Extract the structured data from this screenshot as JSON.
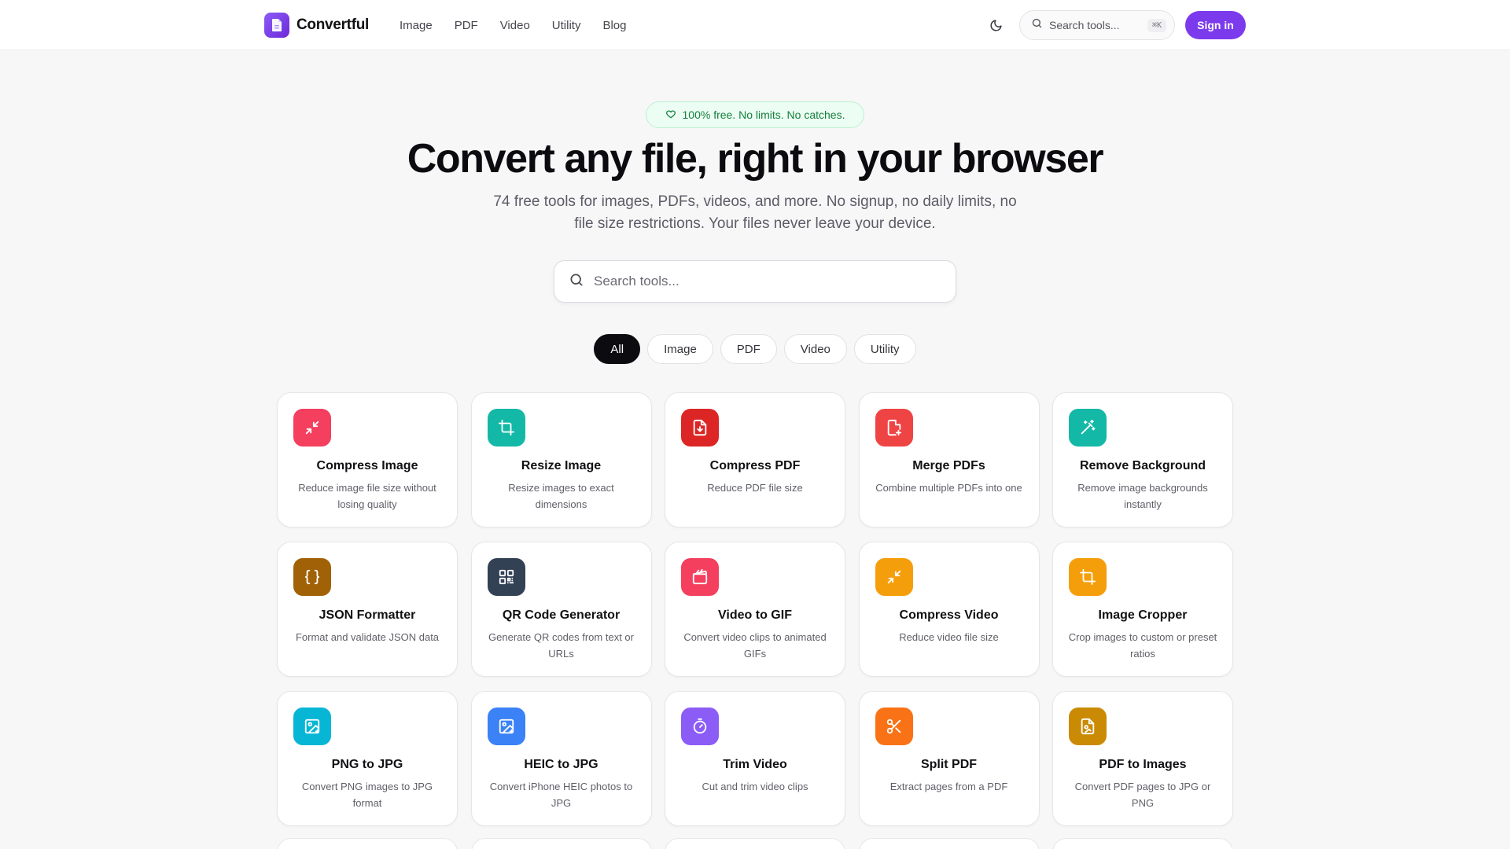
{
  "header": {
    "logo_text": "Convertful",
    "nav": [
      "Image",
      "PDF",
      "Video",
      "Utility",
      "Blog"
    ],
    "search_placeholder": "Search tools...",
    "search_shortcut": "⌘K",
    "signin_label": "Sign in"
  },
  "hero": {
    "badge": "100% free. No limits. No catches.",
    "title": "Convert any file, right in your browser",
    "subtitle_line1": "74 free tools for images, PDFs, videos, and more. No signup, no daily limits, no",
    "subtitle_line2": "file size restrictions. Your files never leave your device.",
    "search_placeholder": "Search tools..."
  },
  "filters": [
    {
      "label": "All",
      "active": true
    },
    {
      "label": "Image",
      "active": false
    },
    {
      "label": "PDF",
      "active": false
    },
    {
      "label": "Video",
      "active": false
    },
    {
      "label": "Utility",
      "active": false
    }
  ],
  "tools": [
    {
      "title": "Compress Image",
      "desc": "Reduce image file size without losing quality",
      "color": "#f43f5e",
      "icon": "compress-arrows-icon"
    },
    {
      "title": "Resize Image",
      "desc": "Resize images to exact dimensions",
      "color": "#14b8a6",
      "icon": "crop-icon"
    },
    {
      "title": "Compress PDF",
      "desc": "Reduce PDF file size",
      "color": "#dc2626",
      "icon": "file-download-icon"
    },
    {
      "title": "Merge PDFs",
      "desc": "Combine multiple PDFs into one",
      "color": "#ef4444",
      "icon": "file-plus-icon"
    },
    {
      "title": "Remove Background",
      "desc": "Remove image backgrounds instantly",
      "color": "#14b8a6",
      "icon": "magic-wand-icon"
    },
    {
      "title": "JSON Formatter",
      "desc": "Format and validate JSON data",
      "color": "#a16207",
      "icon": "braces-icon"
    },
    {
      "title": "QR Code Generator",
      "desc": "Generate QR codes from text or URLs",
      "color": "#334155",
      "icon": "qr-code-icon"
    },
    {
      "title": "Video to GIF",
      "desc": "Convert video clips to animated GIFs",
      "color": "#f43f5e",
      "icon": "clapperboard-icon"
    },
    {
      "title": "Compress Video",
      "desc": "Reduce video file size",
      "color": "#f59e0b",
      "icon": "compress-arrows-icon"
    },
    {
      "title": "Image Cropper",
      "desc": "Crop images to custom or preset ratios",
      "color": "#f59e0b",
      "icon": "crop-icon"
    },
    {
      "title": "PNG to JPG",
      "desc": "Convert PNG images to JPG format",
      "color": "#06b6d4",
      "icon": "image-plus-icon"
    },
    {
      "title": "HEIC to JPG",
      "desc": "Convert iPhone HEIC photos to JPG",
      "color": "#3b82f6",
      "icon": "image-plus-icon"
    },
    {
      "title": "Trim Video",
      "desc": "Cut and trim video clips",
      "color": "#8b5cf6",
      "icon": "timer-icon"
    },
    {
      "title": "Split PDF",
      "desc": "Extract pages from a PDF",
      "color": "#f97316",
      "icon": "scissors-icon"
    },
    {
      "title": "PDF to Images",
      "desc": "Convert PDF pages to JPG or PNG",
      "color": "#ca8a04",
      "icon": "file-image-icon"
    }
  ]
}
